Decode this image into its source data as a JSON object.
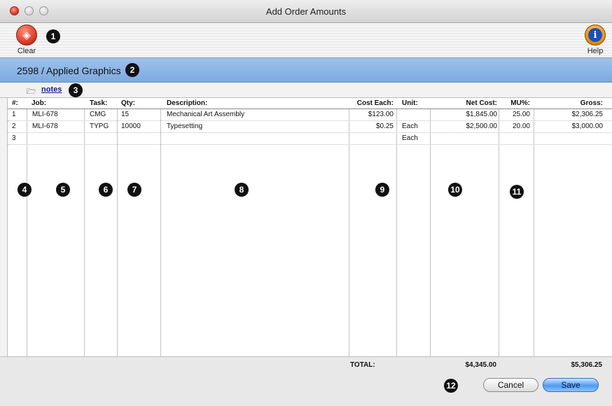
{
  "window": {
    "title": "Add Order Amounts"
  },
  "toolbar": {
    "clear_label": "Clear",
    "help_label": "Help",
    "help_glyph": "i"
  },
  "client": {
    "label": "2598 / Applied Graphics"
  },
  "notes": {
    "link_label": "notes"
  },
  "table": {
    "headers": {
      "num": "#:",
      "job": "Job:",
      "task": "Task:",
      "qty": "Qty:",
      "description": "Description:",
      "cost_each": "Cost Each:",
      "unit": "Unit:",
      "net_cost": "Net Cost:",
      "mu_pct": "MU%:",
      "gross": "Gross:"
    },
    "rows": [
      {
        "num": "1",
        "job": "MLI-678",
        "task": "CMG",
        "qty": "15",
        "description": "Mechanical Art Assembly",
        "cost_each": "$123.00",
        "unit": "",
        "net_cost": "$1,845.00",
        "mu_pct": "25.00",
        "gross": "$2,306.25"
      },
      {
        "num": "2",
        "job": "MLI-678",
        "task": "TYPG",
        "qty": "10000",
        "description": "Typesetting",
        "cost_each": "$0.25",
        "unit": "Each",
        "net_cost": "$2,500.00",
        "mu_pct": "20.00",
        "gross": "$3,000.00"
      },
      {
        "num": "3",
        "job": "",
        "task": "",
        "qty": "",
        "description": "",
        "cost_each": "",
        "unit": "Each",
        "net_cost": "",
        "mu_pct": "",
        "gross": ""
      }
    ]
  },
  "totals": {
    "label": "TOTAL:",
    "net_cost": "$4,345.00",
    "gross": "$5,306.25"
  },
  "buttons": {
    "cancel": "Cancel",
    "save": "Save"
  },
  "callouts": [
    "1",
    "2",
    "3",
    "4",
    "5",
    "6",
    "7",
    "8",
    "9",
    "10",
    "11",
    "12"
  ],
  "colors": {
    "client_bar": "#8bb4e6",
    "save_button": "#4f9af0",
    "close_button": "#e0392b",
    "help_button": "#e88a10"
  }
}
